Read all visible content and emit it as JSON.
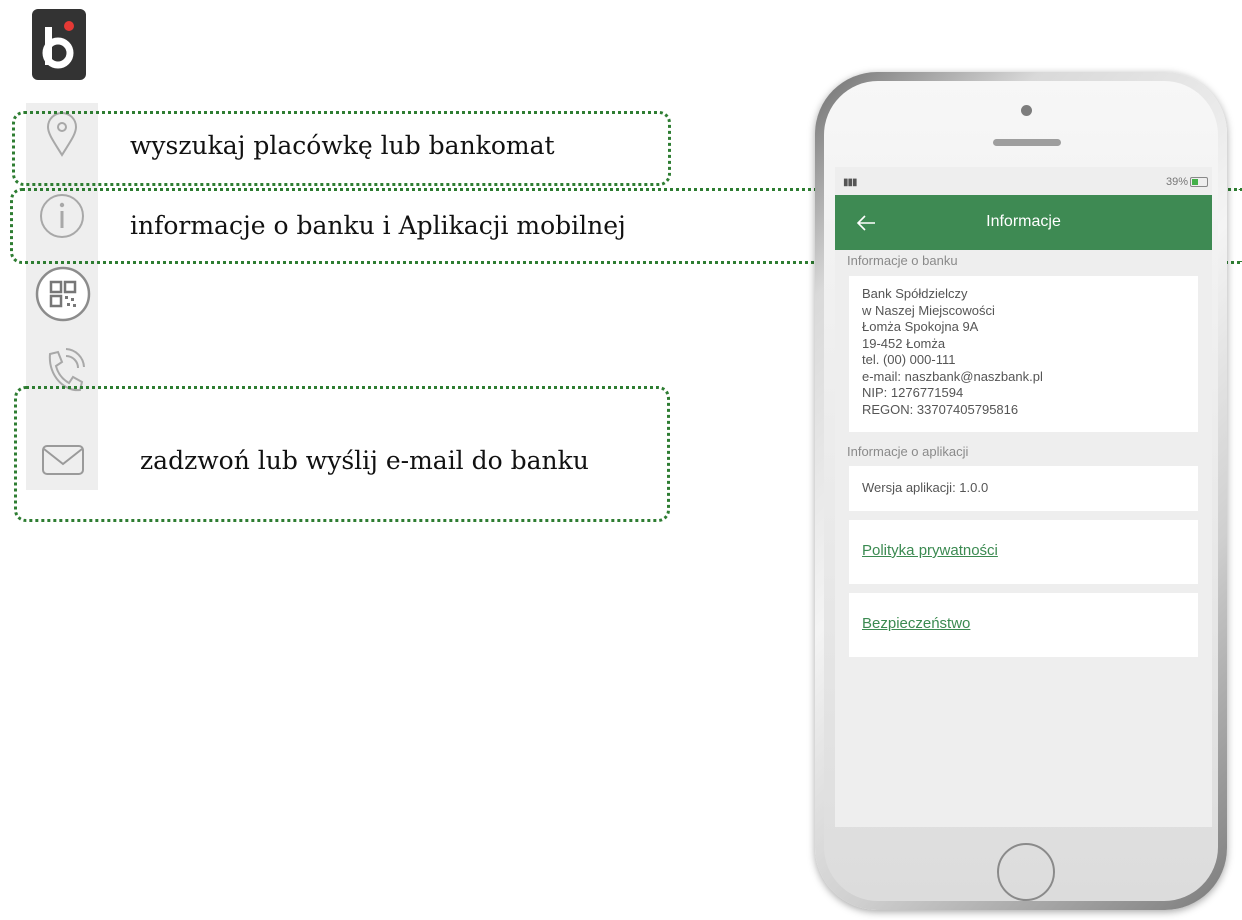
{
  "callouts": {
    "location": "wyszukaj placówkę lub bankomat",
    "info": "informacje o banku i Aplikacji mobilnej",
    "contact": "zadzwoń lub wyślij e-mail do banku"
  },
  "sidebar_icons": [
    "location-pin-icon",
    "info-icon",
    "qr-code-icon",
    "phone-icon",
    "mail-icon"
  ],
  "phone": {
    "status_bar": {
      "battery": "39%"
    },
    "header": {
      "title": "Informacje"
    },
    "bank_section": {
      "label": "Informacje o banku",
      "lines": [
        "Bank Spółdzielczy",
        "w Naszej Miejscowości",
        "Łomża Spokojna 9A",
        "19-452 Łomża",
        "tel. (00) 000-111",
        "e-mail: naszbank@naszbank.pl",
        "NIP: 1276771594",
        "REGON: 33707405795816"
      ]
    },
    "app_section": {
      "label": "Informacje o aplikacji",
      "version": "Wersja aplikacji: 1.0.0"
    },
    "links": {
      "privacy": "Polityka prywatności",
      "security": "Bezpieczeństwo"
    }
  },
  "colors": {
    "header_green": "#3e8a53",
    "frame_green": "#2e7d32",
    "link_green": "#3b8a51"
  }
}
